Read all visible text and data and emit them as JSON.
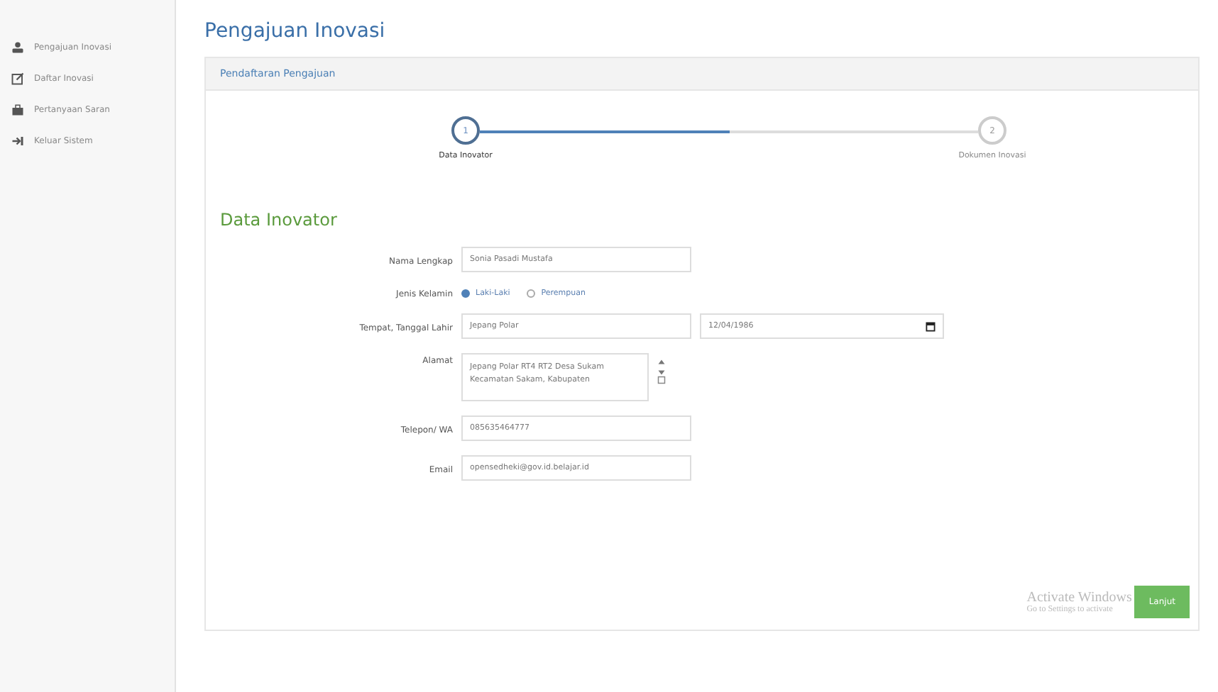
{
  "sidebar": {
    "items": [
      {
        "kind": "user",
        "label": "Pengajuan Inovasi",
        "selected": false
      },
      {
        "kind": "edit",
        "label": "Daftar Inovasi",
        "selected": false
      },
      {
        "kind": "box",
        "label": "Pertanyaan Saran",
        "selected": false
      },
      {
        "kind": "exit",
        "label": "Keluar Sistem",
        "selected": false
      }
    ]
  },
  "page_title": "Pengajuan Inovasi",
  "panel": {
    "title": "Pendaftaran Pengajuan",
    "steps": [
      {
        "number": "1",
        "label": "Data Inovator",
        "selected": true
      },
      {
        "number": "2",
        "label": "Dokumen Inovasi",
        "selected": false
      }
    ],
    "section_title": "Data Inovator",
    "fields": [
      {
        "kind": "text",
        "label": "Nama Lengkap",
        "value": "Sonia Pasadi Mustafa"
      },
      {
        "kind": "radio",
        "label": "Jenis Kelamin",
        "options": [
          {
            "label": "Laki-Laki",
            "selected": true
          },
          {
            "label": "Perempuan",
            "selected": false
          }
        ]
      },
      {
        "kind": "place_date",
        "label": "Tempat, Tanggal Lahir",
        "value": "Jepang Polar",
        "date": "12/04/1986"
      },
      {
        "kind": "textarea",
        "label": "Alamat",
        "value": "Jepang Polar RT4 RT2 Desa Sukam Kecamatan Sakam, Kabupaten"
      },
      {
        "kind": "text",
        "label": "Telepon/ WA",
        "value": "085635464777"
      },
      {
        "kind": "text",
        "label": "Email",
        "value": "opensedheki@gov.id.belajar.id"
      }
    ],
    "button": "Lanjut"
  },
  "os_notice": {
    "title": "Activate Windows",
    "text": "Go to Settings to activate"
  }
}
